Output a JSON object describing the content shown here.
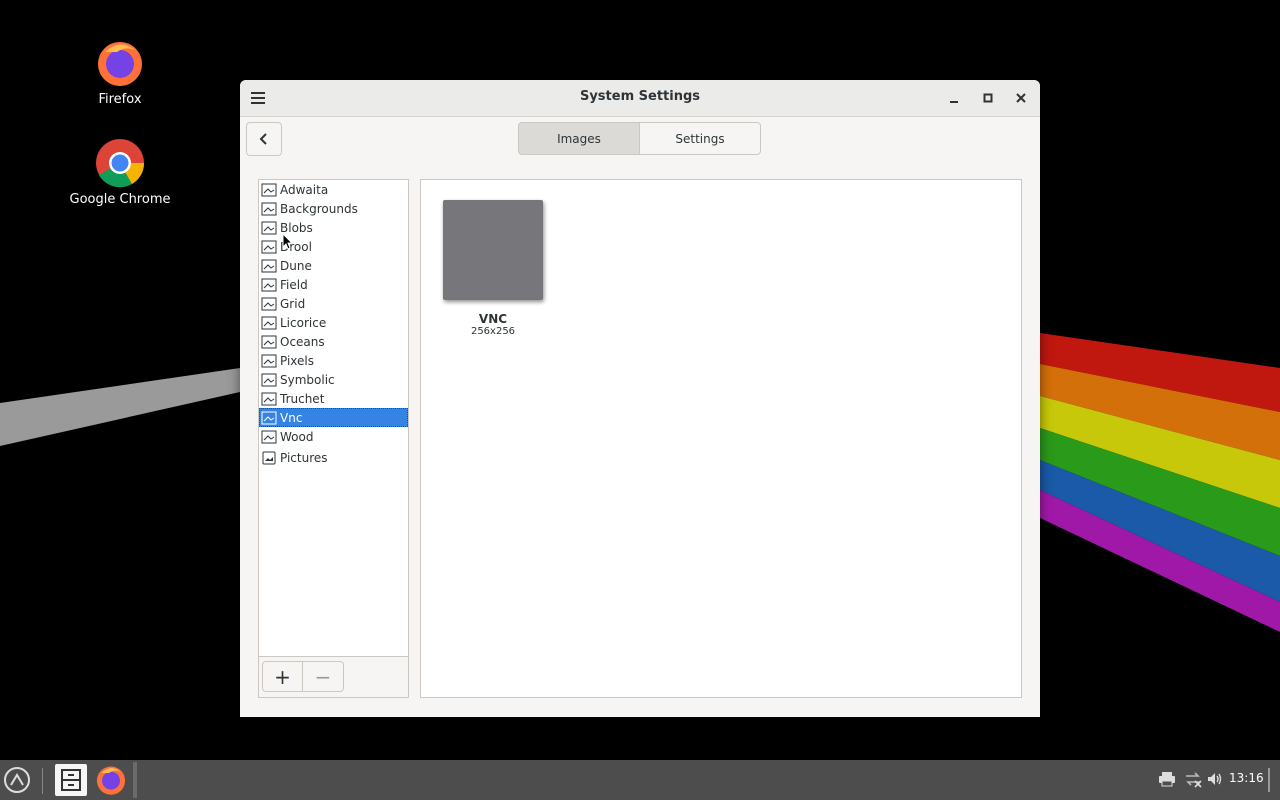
{
  "desktop": {
    "icons": [
      {
        "label": "Firefox",
        "icon": "firefox-icon"
      },
      {
        "label": "Google Chrome",
        "icon": "chrome-icon"
      }
    ]
  },
  "window": {
    "title": "System Settings",
    "tabs": [
      {
        "label": "Images",
        "active": true
      },
      {
        "label": "Settings",
        "active": false
      }
    ],
    "sidebar": {
      "items": [
        {
          "label": "Adwaita"
        },
        {
          "label": "Backgrounds"
        },
        {
          "label": "Blobs"
        },
        {
          "label": "Drool"
        },
        {
          "label": "Dune"
        },
        {
          "label": "Field"
        },
        {
          "label": "Grid"
        },
        {
          "label": "Licorice"
        },
        {
          "label": "Oceans"
        },
        {
          "label": "Pixels"
        },
        {
          "label": "Symbolic"
        },
        {
          "label": "Truchet"
        },
        {
          "label": "Vnc",
          "selected": true
        },
        {
          "label": "Wood"
        }
      ],
      "pictures_label": "Pictures",
      "add_label": "+",
      "remove_label": "−"
    },
    "content": {
      "items": [
        {
          "name": "VNC",
          "size": "256x256",
          "color": "#77767b"
        }
      ]
    }
  },
  "taskbar": {
    "clock": "13:16"
  },
  "colors": {
    "selection": "#3584e4",
    "taskbar": "#4d4d4d"
  }
}
